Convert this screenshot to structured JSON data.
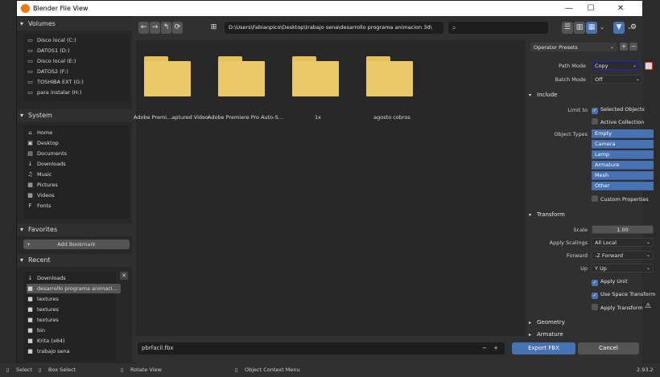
{
  "window": {
    "title": "Blender File View",
    "minimize": "—",
    "maximize": "☐",
    "close": "✕"
  },
  "toolbar": {
    "back": "←",
    "forward": "→",
    "parent": "↰",
    "refresh": "⟳",
    "new_folder": "⊞",
    "path": "D:\\Users\\Fabianpico\\Desktop\\trabajo sena\\desarrollo programa animacion 3d\\",
    "search_placeholder": "⌕",
    "filter": "▼",
    "settings": "⚙"
  },
  "sidebar": {
    "volumes_title": "Volumes",
    "volumes": [
      {
        "label": "Disco local (C:)",
        "icon": "drive-icon"
      },
      {
        "label": "DATOS1 (D:)",
        "icon": "drive-icon"
      },
      {
        "label": "Disco local (E:)",
        "icon": "drive-icon"
      },
      {
        "label": "DATOS2 (F:)",
        "icon": "drive-icon"
      },
      {
        "label": "TOSHIBA EXT (G:)",
        "icon": "drive-icon"
      },
      {
        "label": "para instalar (H:)",
        "icon": "drive-icon"
      }
    ],
    "system_title": "System",
    "system": [
      {
        "label": "Home",
        "icon": "home-icon"
      },
      {
        "label": "Desktop",
        "icon": "desktop-icon"
      },
      {
        "label": "Documents",
        "icon": "documents-icon"
      },
      {
        "label": "Downloads",
        "icon": "download-icon"
      },
      {
        "label": "Music",
        "icon": "music-icon"
      },
      {
        "label": "Pictures",
        "icon": "pictures-icon"
      },
      {
        "label": "Videos",
        "icon": "videos-icon"
      },
      {
        "label": "Fonts",
        "icon": "fonts-icon"
      }
    ],
    "favorites_title": "Favorites",
    "add_bookmark": "Add Bookmark",
    "recent_title": "Recent",
    "recent": [
      {
        "label": "Downloads",
        "icon": "download-icon"
      },
      {
        "label": "desarrollo programa animaci...",
        "icon": "folder-icon"
      },
      {
        "label": "textures",
        "icon": "folder-icon"
      },
      {
        "label": "textures",
        "icon": "folder-icon"
      },
      {
        "label": "textures",
        "icon": "folder-icon"
      },
      {
        "label": "bin",
        "icon": "folder-icon"
      },
      {
        "label": "Krita (x64)",
        "icon": "folder-icon"
      },
      {
        "label": "trabajo sena",
        "icon": "folder-icon"
      }
    ]
  },
  "files": [
    {
      "label": "Adobe Premi...aptured Video"
    },
    {
      "label": "Adobe Premiere Pro Auto-S..."
    },
    {
      "label": "1x"
    },
    {
      "label": "agosto cobros"
    }
  ],
  "bottom": {
    "filename": "pbrfacil.fbx",
    "minus": "−",
    "plus": "+",
    "export_label": "Export FBX",
    "cancel_label": "Cancel"
  },
  "props": {
    "presets_label": "Operator Presets",
    "path_mode_label": "Path Mode",
    "path_mode_value": "Copy",
    "batch_mode_label": "Batch Mode",
    "batch_mode_value": "Off",
    "include_title": "Include",
    "limit_to_label": "Limit to",
    "selected_objects": "Selected Objects",
    "active_collection": "Active Collection",
    "object_types_label": "Object Types",
    "object_types": [
      "Empty",
      "Camera",
      "Lamp",
      "Armature",
      "Mesh",
      "Other"
    ],
    "custom_properties": "Custom Properties",
    "transform_title": "Transform",
    "scale_label": "Scale",
    "scale_value": "1.00",
    "apply_scalings_label": "Apply Scalings",
    "apply_scalings_value": "All Local",
    "forward_label": "Forward",
    "forward_value": "-Z Forward",
    "up_label": "Up",
    "up_value": "Y Up",
    "apply_unit": "Apply Unit",
    "use_space_transform": "Use Space Transform",
    "apply_transform": "Apply Transform",
    "geometry_title": "Geometry",
    "armature_title": "Armature"
  },
  "status": {
    "select": "Select",
    "box_select": "Box Select",
    "rotate_view": "Rotate View",
    "object_context_menu": "Object Context Menu",
    "version": "2.93.2"
  },
  "colors": {
    "accent": "#4772b3",
    "folder": "#ebc868",
    "highlight_outline": "#2323c8"
  }
}
